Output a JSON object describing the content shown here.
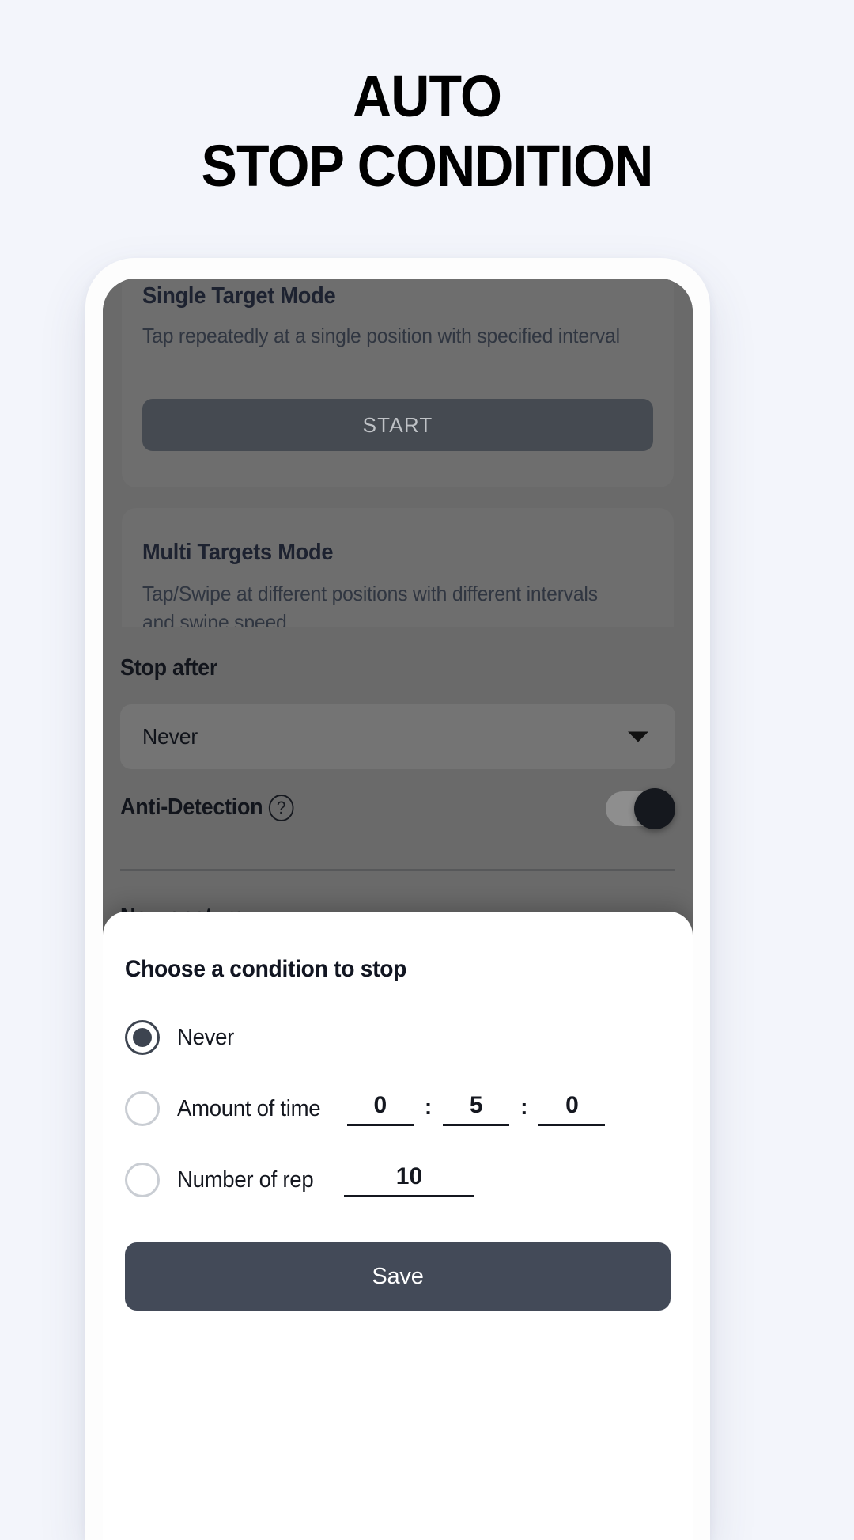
{
  "headline": {
    "line1": "AUTO",
    "line2": "STOP CONDITION"
  },
  "app": {
    "single_target": {
      "title": "Single Target Mode",
      "description": "Tap repeatedly at a single position with specified interval",
      "start_label": "START"
    },
    "multi_target": {
      "title": "Multi Targets Mode",
      "description": "Tap/Swipe at different positions with different intervals and swipe speed"
    },
    "floating_toolbar": {
      "icons": [
        "collapse-up-icon",
        "minimize-icon",
        "gear-icon",
        "save-icon",
        "close-icon",
        "move-icon"
      ]
    },
    "settings": {
      "stop_after_label": "Stop after",
      "stop_after_value": "Never",
      "anti_detection_label": "Anti-Detection",
      "anti_detection_help": "?",
      "anti_detection_on": true,
      "new_gesture_label": "New gesture"
    }
  },
  "sheet": {
    "title": "Choose a condition to stop",
    "options": [
      {
        "label": "Never",
        "selected": true
      },
      {
        "label": "Amount of time",
        "selected": false
      },
      {
        "label": "Number of rep",
        "selected": false
      }
    ],
    "time": {
      "hours": "0",
      "minutes": "5",
      "seconds": "0",
      "separator": ":"
    },
    "reps": "10",
    "save_label": "Save"
  },
  "colors": {
    "page_bg": "#f3f5fb",
    "accent_dark": "#434a58",
    "toolbar_bg": "#22262f",
    "dim_overlay": "#6a6a6a"
  }
}
